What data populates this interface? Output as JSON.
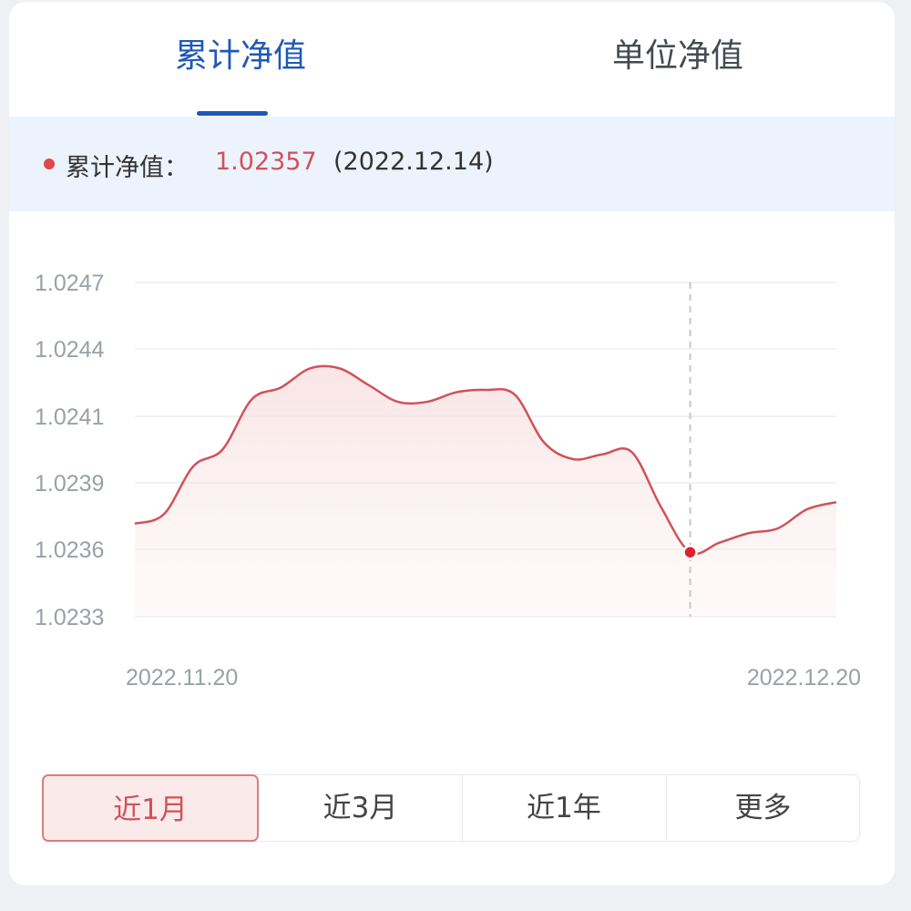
{
  "tabs": [
    {
      "label": "累计净值",
      "active": true
    },
    {
      "label": "单位净值",
      "active": false
    }
  ],
  "info": {
    "label": "累计净值：",
    "value": "1.02357",
    "date": "(2022.12.14)"
  },
  "colors": {
    "accent_blue": "#1f58b8",
    "line_red": "#d0525a",
    "marker_red": "#e0202a",
    "info_bg": "#edf3fd"
  },
  "chart_data": {
    "type": "area",
    "y_ticks": [
      "1.0247",
      "1.0244",
      "1.0241",
      "1.0239",
      "1.0236",
      "1.0233"
    ],
    "x_labels": [
      "2022.11.20",
      "2022.12.20"
    ],
    "ylim": [
      1.0233,
      1.0247
    ],
    "grid": true,
    "values": [
      1.02369,
      1.02373,
      1.02393,
      1.024,
      1.02421,
      1.02426,
      1.02434,
      1.02434,
      1.02427,
      1.0242,
      1.0242,
      1.02424,
      1.02425,
      1.02423,
      1.02403,
      1.02396,
      1.02398,
      1.02399,
      1.02376,
      1.02357,
      1.02361,
      1.02365,
      1.02367,
      1.02375,
      1.02378
    ],
    "highlight": {
      "index": 19,
      "value": 1.02357,
      "date": "2022.12.14"
    }
  },
  "ranges": [
    {
      "label": "近1月",
      "active": true
    },
    {
      "label": "近3月",
      "active": false
    },
    {
      "label": "近1年",
      "active": false
    },
    {
      "label": "更多",
      "active": false
    }
  ]
}
